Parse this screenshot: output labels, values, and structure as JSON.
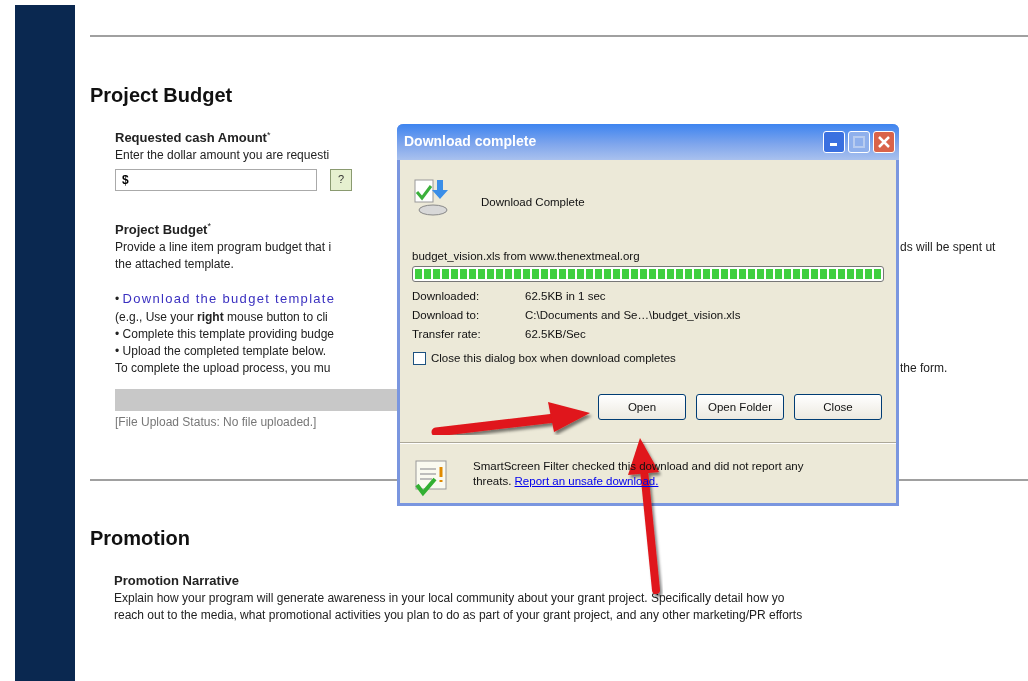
{
  "budget_section": {
    "heading": "Project Budget",
    "amount": {
      "label": "Requested cash Amount$^{*}$",
      "hint": "Enter the dollar amount you are requesti",
      "value": "$",
      "help": "?"
    },
    "budget": {
      "label": "Project Budget$^{*}$",
      "lines": [
        {
          "kind": "text",
          "text": "Provide a line item program budget that i",
          "right": "ds will be spent ut"
        },
        {
          "kind": "text",
          "text": "the attached template."
        },
        {
          "kind": "link",
          "bullet": "•",
          "text": "Download the budget template"
        },
        {
          "kind": "text",
          "text": "(e.g., Use your **right** mouse button to cli"
        },
        {
          "kind": "text",
          "text": "• Complete this template providing budge"
        },
        {
          "kind": "text",
          "text": "• Upload the completed template below."
        },
        {
          "kind": "text",
          "text": "To complete the upload process, you mu",
          "right": "the form."
        }
      ]
    },
    "upload_status": "[File Upload Status: No file uploaded.]"
  },
  "promotion_section": {
    "heading": "Promotion",
    "label": "Promotion Narrative",
    "lines": [
      "Explain how your program will generate awareness in your local community about your grant project. Specifically detail how yo",
      "reach out to the media, what promotional activities you plan to do as part of your grant project, and any other marketing/PR efforts"
    ]
  },
  "dialog": {
    "title": "Download complete",
    "heading": "Download Complete",
    "source": "budget_vision.xls from www.thenextmeal.org",
    "progress": {
      "level": 1
    },
    "details": [
      {
        "label": "Downloaded:",
        "value": "62.5KB in 1 sec"
      },
      {
        "label": "Download to:",
        "value": "C:\\Documents and Se…\\budget_vision.xls"
      },
      {
        "label": "Transfer rate:",
        "value": "62.5KB/Sec"
      }
    ],
    "close_when_done": {
      "label": "Close this dialog box when download completes",
      "checked": false
    },
    "buttons": [
      "Open",
      "Open Folder",
      "Close"
    ],
    "smartscreen": {
      "text": "SmartScreen Filter checked this download and did not report any threats.",
      "link": "Report an unsafe download."
    }
  }
}
